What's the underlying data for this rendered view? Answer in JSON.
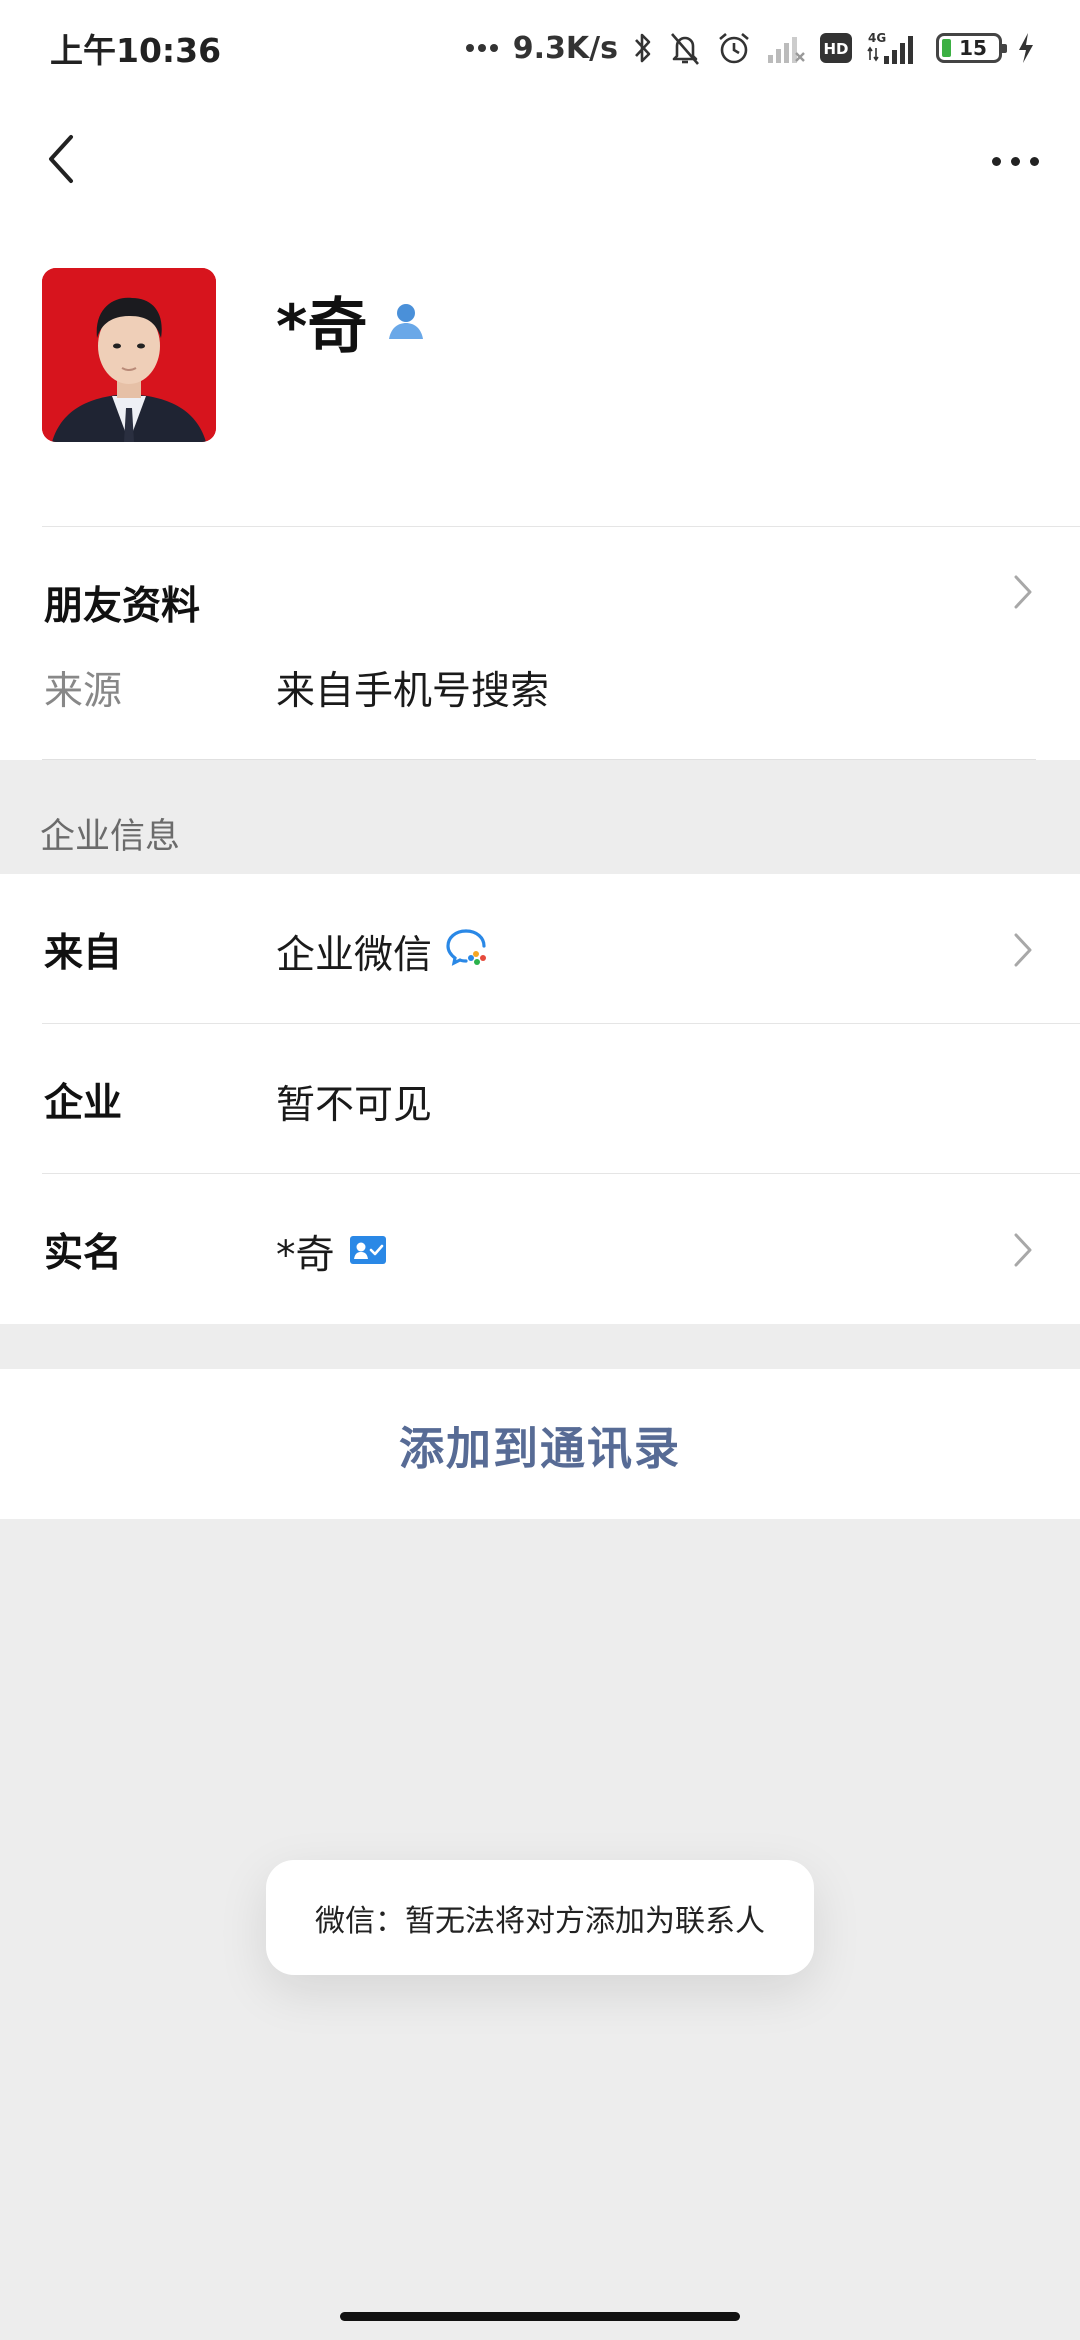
{
  "status_bar": {
    "time": "上午10:36",
    "net_speed": "9.3K/s",
    "network_type": "4G",
    "hd_badge": "HD",
    "battery_level": "15",
    "icons": [
      "dots-icon",
      "bluetooth-icon",
      "bell-muted-icon",
      "alarm-icon",
      "signal-weak-icon",
      "hd-icon",
      "signal-4g-icon",
      "battery-icon",
      "charging-icon"
    ]
  },
  "nav": {
    "back_icon": "chevron-left-icon",
    "more_icon": "more-horizontal-icon"
  },
  "profile": {
    "name": "*奇",
    "badge_icon": "contact-person-icon",
    "avatar_bg": "#d7141d"
  },
  "friend_info": {
    "title": "朋友资料",
    "source_label": "来源",
    "source_value": "来自手机号搜索"
  },
  "enterprise": {
    "section_title": "企业信息",
    "rows": [
      {
        "label": "来自",
        "value": "企业微信",
        "icon": "wecom-logo-icon",
        "has_chevron": true
      },
      {
        "label": "企业",
        "value": "暂不可见",
        "has_chevron": false
      },
      {
        "label": "实名",
        "value": "*奇",
        "icon": "verified-id-icon",
        "has_chevron": true
      }
    ]
  },
  "actions": {
    "add_contact": "添加到通讯录"
  },
  "toast": {
    "message": "微信：暂无法将对方添加为联系人"
  },
  "colors": {
    "link_blue": "#576b95",
    "page_bg": "#ededed",
    "card_bg": "#ffffff"
  }
}
